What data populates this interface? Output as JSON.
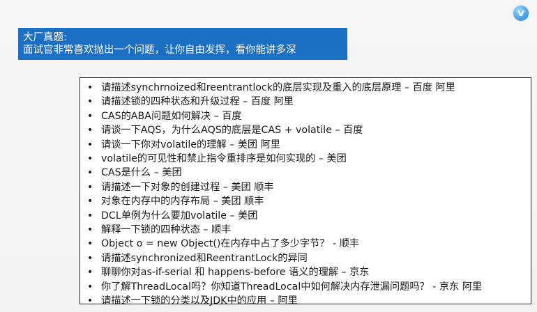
{
  "header": {
    "line1": "大厂真题:",
    "line2": "面试官非常喜欢抛出一个问题，让你自由发挥，看你能讲多深"
  },
  "logo": {
    "icon": "brand-logo-icon",
    "color": "#4aa6ee"
  },
  "questions": [
    "请描述synchrnoized和reentrantlock的底层实现及重入的底层原理 – 百度 阿里",
    "请描述锁的四种状态和升级过程 – 百度 阿里",
    "CAS的ABA问题如何解决 – 百度",
    "请谈一下AQS，为什么AQS的底层是CAS + volatile – 百度",
    "请谈一下你对volatile的理解 – 美团 阿里",
    "volatile的可见性和禁止指令重排序是如何实现的 – 美团",
    "CAS是什么 – 美团",
    "请描述一下对象的创建过程 – 美团 顺丰",
    "对象在内存中的内存布局 – 美团 顺丰",
    "DCL单例为什么要加volatile – 美团",
    "解释一下锁的四种状态 – 顺丰",
    "Object o = new Object()在内存中占了多少字节？ - 顺丰",
    "请描述synchronized和ReentrantLock的异同",
    "聊聊你对as-if-serial 和 happens-before 语义的理解 – 京东",
    "你了解ThreadLocal吗？你知道ThreadLocal中如何解决内存泄漏问题吗？ - 京东 阿里",
    "请描述一下锁的分类以及JDK中的应用 – 阿里"
  ],
  "colors": {
    "header_bg": "#1b6fc4",
    "header_text": "#ffffff",
    "list_bg": "#ffffff",
    "list_border": "#2a2a2a",
    "text": "#1a1a1a"
  }
}
